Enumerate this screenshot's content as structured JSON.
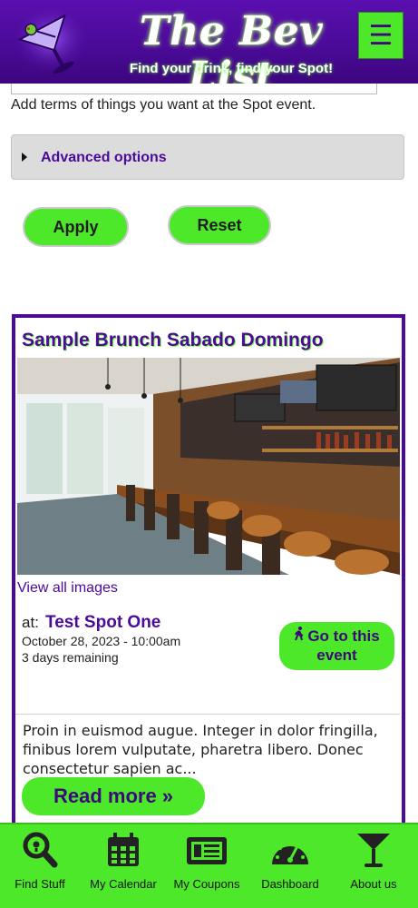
{
  "header": {
    "brand": "The Bev List",
    "tagline": "Find your drink, find your Spot!",
    "menu_icon": "☰"
  },
  "search": {
    "help_text": "Add terms of things you want at the Spot event.",
    "advanced_label": "Advanced options",
    "apply_label": "Apply",
    "reset_label": "Reset"
  },
  "event": {
    "title": "Sample Brunch Sabado Domingo",
    "view_images": "View all images",
    "at_label": "at:",
    "spot_name": "Test Spot One",
    "date": "October 28, 2023 - 10:00am",
    "remaining": "3 days remaining",
    "goto_label": "Go to this event",
    "description": "Proin in euismod augue. Integer in dolor fringilla, finibus lorem vulputate, pharetra libero. Donec consectetur sapien ac...",
    "read_more": "Read more »"
  },
  "bottom_nav": {
    "find": "Find Stuff",
    "calendar": "My Calendar",
    "coupons": "My Coupons",
    "dashboard": "Dashboard",
    "about": "About us"
  },
  "colors": {
    "brand_purple": "#4b0a98",
    "accent_green": "#4ee82b"
  },
  "icons": [
    "martini-logo-icon",
    "hamburger-menu-icon",
    "disclosure-triangle-icon",
    "walking-icon",
    "search-icon",
    "calendar-icon",
    "coupons-icon",
    "dashboard-gauge-icon",
    "martini-icon"
  ]
}
